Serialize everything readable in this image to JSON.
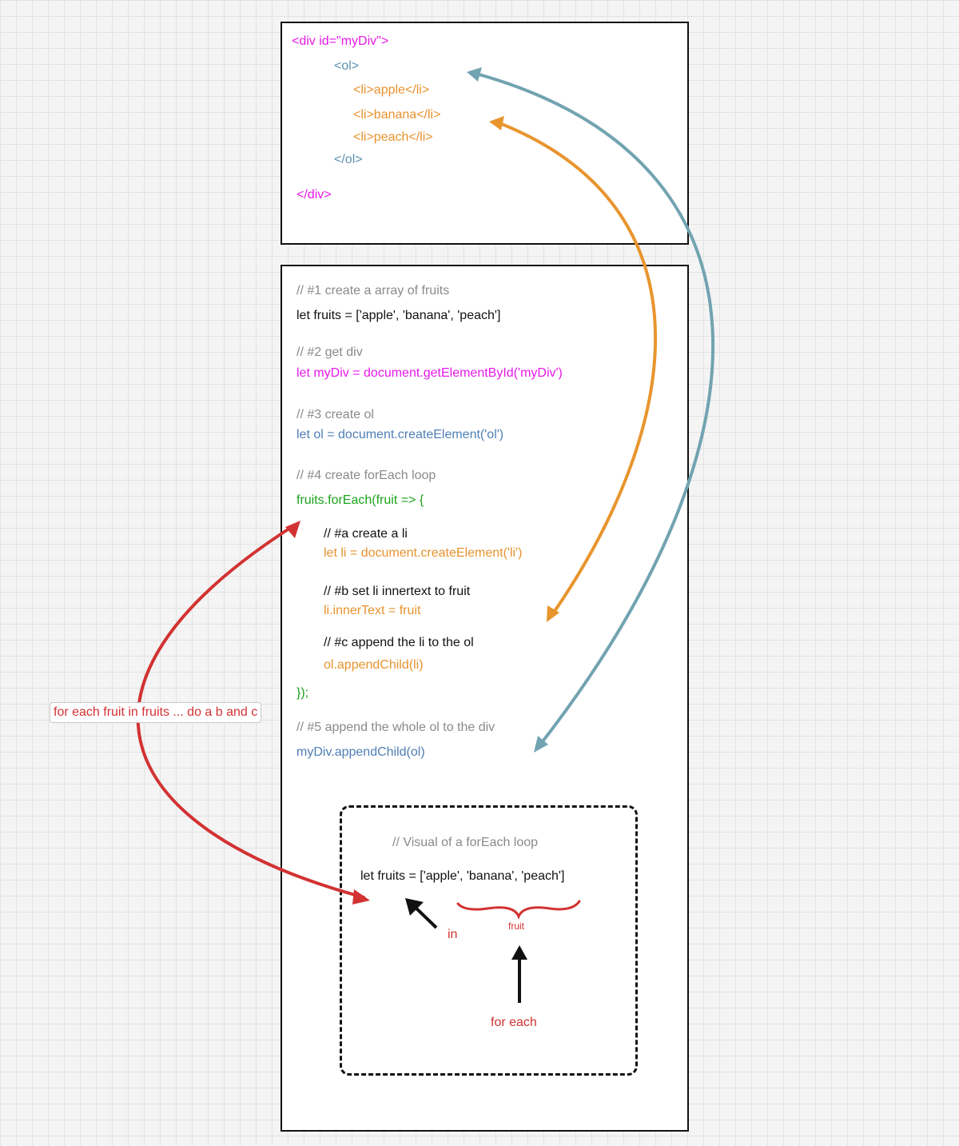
{
  "html_box": {
    "line1": "<div id=\"myDiv\">",
    "line2": "<ol>",
    "line3": "<li>apple</li>",
    "line4": "<li>banana</li>",
    "line5": "<li>peach</li>",
    "line6": "</ol>",
    "line7": "</div>"
  },
  "js_box": {
    "c1": "// #1 create a array of fruits",
    "s1": "let fruits = ['apple', 'banana', 'peach']",
    "c2": "// #2  get div",
    "s2": "let myDiv = document.getElementById('myDiv')",
    "c3": "// #3 create ol",
    "s3": "let ol = document.createElement('ol')",
    "c4": "// #4 create forEach loop",
    "s4": "fruits.forEach(fruit => {",
    "ca": "// #a create a li",
    "sa": "let li = document.createElement('li')",
    "cb": "// #b set li innertext to fruit",
    "sb": "li.innerText = fruit",
    "cc": "// #c append the li to the ol",
    "sc": "ol.appendChild(li)",
    "close": "});",
    "c5": "// #5 append the whole ol to the div",
    "s5": "myDiv.appendChild(ol)"
  },
  "visual": {
    "comment": "// Visual of a forEach loop",
    "code": "let fruits = ['apple', 'banana', 'peach']",
    "fruit_label": "fruit",
    "in_label": "in",
    "for_each_label": "for each"
  },
  "loop_label": "for each fruit in fruits ... do a b and c",
  "colors": {
    "magenta": "#e619e6",
    "teal": "#5b93ad",
    "orange": "#e8932e",
    "gray": "#8a8a8a",
    "green": "#1aa31a",
    "blue": "#4f7fb5",
    "red": "#d23232",
    "teal_arrow": "#72a3b1",
    "orange_arrow": "#e8952e"
  }
}
